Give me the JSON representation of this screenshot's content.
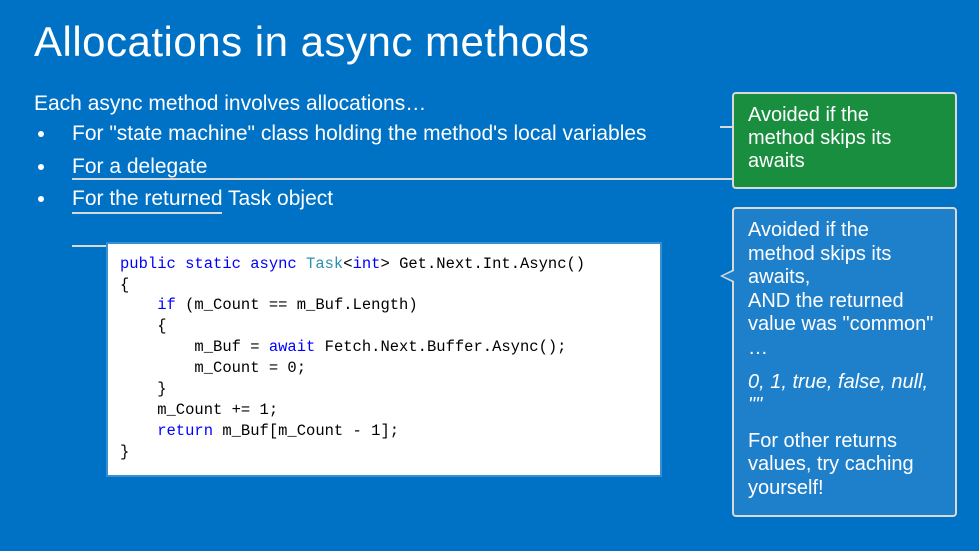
{
  "title": "Allocations in async methods",
  "subhead": "Each async method involves allocations…",
  "bullets": [
    "For \"state machine\" class holding the method's local variables",
    "For a delegate",
    "For the returned Task object"
  ],
  "code": {
    "l1_pre": "public static async ",
    "l1_type": "Task",
    "l1_gen1": "<",
    "l1_int": "int",
    "l1_gen2": "> Get.Next.Int.Async()",
    "l2": "{",
    "l3_if": "    if",
    "l3_rest": " (m_Count == m_Buf.Length)",
    "l4": "    {",
    "l5_pre": "        m_Buf = ",
    "l5_await": "await",
    "l5_post": " Fetch.Next.Buffer.Async();",
    "l6": "        m_Count = 0;",
    "l7": "    }",
    "l8": "    m_Count += 1;",
    "l9_ret": "    return",
    "l9_rest": " m_Buf[m_Count - 1];",
    "l10": "}"
  },
  "callout_green": "Avoided if the method skips its awaits",
  "callout_blue": {
    "p1": "Avoided if the method skips its awaits,\nAND the returned value was \"common\" …",
    "italic": "0, 1, true, false, null, \"\"",
    "p2": "For other returns values, try caching yourself!"
  }
}
